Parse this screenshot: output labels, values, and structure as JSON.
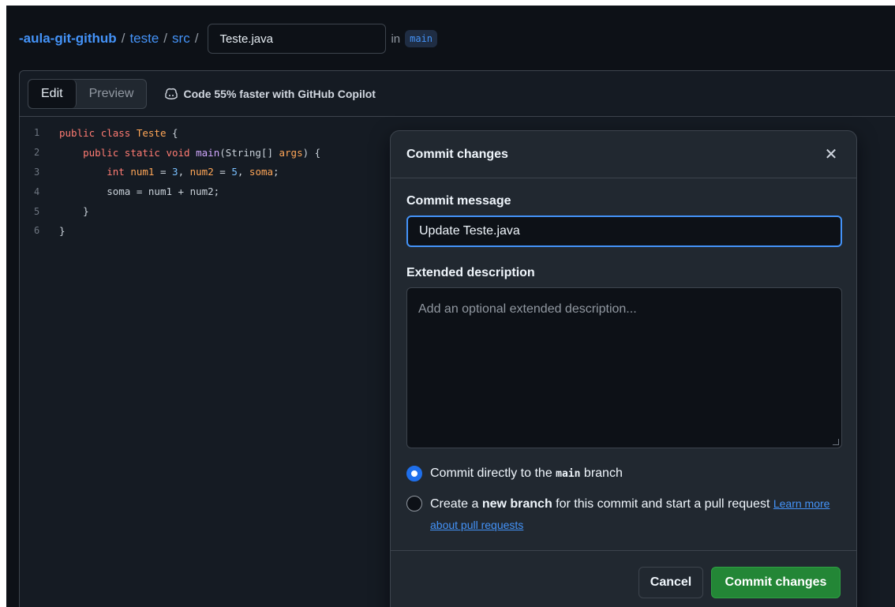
{
  "breadcrumb": {
    "repo": "-aula-git-github",
    "separator": "/",
    "path": [
      "teste",
      "src"
    ],
    "filename_value": "Teste.java",
    "in_word": "in",
    "branch": "main"
  },
  "editor": {
    "tabs": [
      "Edit",
      "Preview"
    ],
    "copilot_text": "Code 55% faster with GitHub Copilot",
    "line_numbers": [
      "1",
      "2",
      "3",
      "4",
      "5",
      "6"
    ]
  },
  "dialog": {
    "title": "Commit changes",
    "close_icon": "close-icon",
    "message_label": "Commit message",
    "message_value": "Update Teste.java",
    "description_label": "Extended description",
    "description_placeholder": "Add an optional extended description...",
    "option_direct": {
      "prefix": "Commit directly to the ",
      "branch": "main",
      "suffix": " branch"
    },
    "option_new": {
      "prefix": "Create a ",
      "bold": "new branch",
      "suffix": " for this commit and start a pull request ",
      "link": "Learn more about pull requests"
    },
    "cancel_label": "Cancel",
    "commit_label": "Commit changes"
  },
  "colors": {
    "accent": "#4493f8",
    "commit_button": "#238636",
    "background": "#0d1117"
  }
}
